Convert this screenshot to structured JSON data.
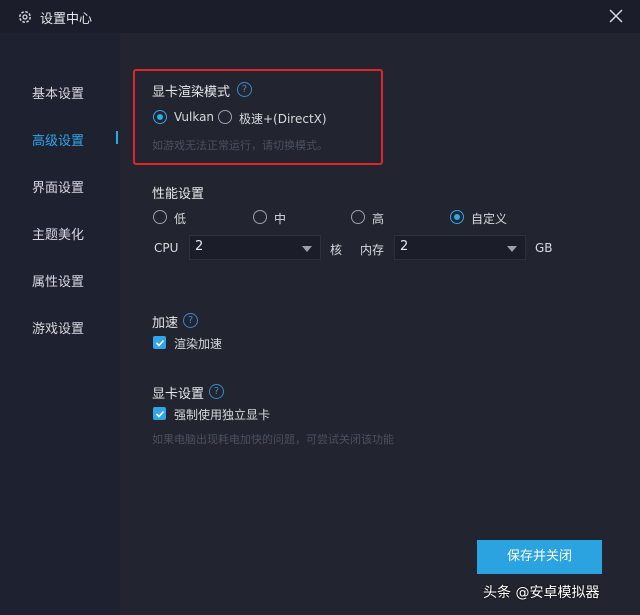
{
  "window": {
    "title": "设置中心",
    "close_icon": "close-icon",
    "settings_icon": "gear-icon"
  },
  "sidebar": {
    "items": [
      {
        "label": "基本设置",
        "active": false
      },
      {
        "label": "高级设置",
        "active": true
      },
      {
        "label": "界面设置",
        "active": false
      },
      {
        "label": "主题美化",
        "active": false
      },
      {
        "label": "属性设置",
        "active": false
      },
      {
        "label": "游戏设置",
        "active": false
      }
    ]
  },
  "render": {
    "title": "显卡渲染模式",
    "help": "?",
    "options": [
      {
        "label": "Vulkan",
        "checked": true
      },
      {
        "label": "极速+(DirectX)",
        "checked": false
      }
    ],
    "hint": "如游戏无法正常运行，请切换模式。"
  },
  "performance": {
    "title": "性能设置",
    "options": [
      {
        "label": "低",
        "checked": false
      },
      {
        "label": "中",
        "checked": false
      },
      {
        "label": "高",
        "checked": false
      },
      {
        "label": "自定义",
        "checked": true
      }
    ],
    "cpu_label": "CPU",
    "cpu_value": "2",
    "cpu_unit": "核",
    "mem_label": "内存",
    "mem_value": "2",
    "mem_unit": "GB"
  },
  "accel": {
    "title": "加速",
    "help": "?",
    "checkbox_label": "渲染加速",
    "checked": true
  },
  "gpu": {
    "title": "显卡设置",
    "help": "?",
    "checkbox_label": "强制使用独立显卡",
    "checked": true,
    "hint": "如果电脑出现耗电加快的问题，可尝试关闭该功能"
  },
  "footer": {
    "save_label": "保存并关闭"
  },
  "watermark": "头条 @安卓模拟器",
  "colors": {
    "accent": "#2fa6e8",
    "highlight": "#e0252a",
    "background": "#22252f"
  }
}
